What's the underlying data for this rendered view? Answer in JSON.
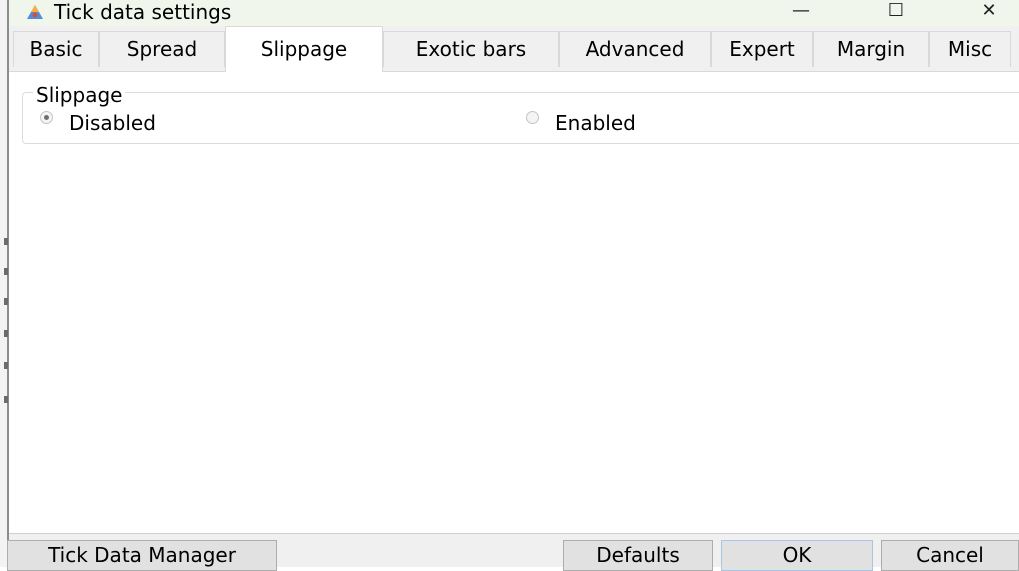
{
  "window": {
    "title": "Tick data settings",
    "controls": {
      "minimize": "—",
      "maximize": "☐",
      "close": "✕"
    }
  },
  "tabs": [
    {
      "label": "Basic",
      "active": false
    },
    {
      "label": "Spread",
      "active": false
    },
    {
      "label": "Slippage",
      "active": true
    },
    {
      "label": "Exotic bars",
      "active": false
    },
    {
      "label": "Advanced",
      "active": false
    },
    {
      "label": "Expert",
      "active": false
    },
    {
      "label": "Margin",
      "active": false
    },
    {
      "label": "Misc",
      "active": false
    }
  ],
  "slippage_group": {
    "legend": "Slippage",
    "options": [
      {
        "label": "Disabled",
        "selected": true
      },
      {
        "label": "Enabled",
        "selected": false
      }
    ]
  },
  "footer": {
    "tick_data_manager_label": "Tick Data Manager",
    "defaults_label": "Defaults",
    "ok_label": "OK",
    "cancel_label": "Cancel"
  },
  "colors": {
    "titlebar_bg": "#f0f6ec",
    "tab_bg": "#f0f0f0",
    "button_bg": "#e1e1e1",
    "ok_border": "#a7c5e4"
  }
}
